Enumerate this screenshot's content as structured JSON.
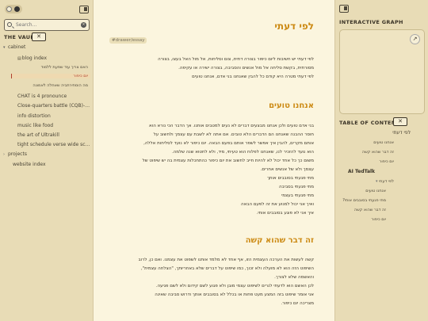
{
  "left": {
    "search": {
      "placeholder": "Search...",
      "value": ""
    },
    "vault_label": "THE VAULT",
    "collapse_glyph": "✕",
    "tree": [
      {
        "label": "cabinet",
        "kind": "folder",
        "expanded": true
      },
      {
        "label": "blog index",
        "kind": "file"
      },
      {
        "label": "האם צריך עוד שפעת ללמוד",
        "kind": "sub"
      },
      {
        "label": "יום כיפור",
        "kind": "sub",
        "active": true
      },
      {
        "label": "מה הוסתירתביה שאחלה לאמונה",
        "kind": "sub"
      },
      {
        "label": "CHAT is 4 pronounce",
        "kind": "file"
      },
      {
        "label": "Close-quarters battle (CQB)-t...",
        "kind": "file"
      },
      {
        "label": "info distortion",
        "kind": "file"
      },
      {
        "label": "music like food",
        "kind": "file"
      },
      {
        "label": "the art of Ultrakill",
        "kind": "file"
      },
      {
        "label": "tight schedule verse wide sch...",
        "kind": "file"
      },
      {
        "label": "projects",
        "kind": "folder",
        "expanded": false
      },
      {
        "label": "website index",
        "kind": "file"
      }
    ]
  },
  "main": {
    "title": "לפי דעתי",
    "tag": "#drawer/essay",
    "intro": [
      "לפי דעתי יש חשיבות ליום כיפור בצורה דתית, צום וסליחות, אל מול האל בעצו, בצורה",
      "מסורתית, בקשת סליחה אל מול אנשים והסביבה, בצורה ישירה או עקיפה.",
      "לפי דעתי מטרה היא קודם כל להבין שאנחנו בני אדם, אנחנו טועים"
    ],
    "section1": {
      "heading": "אנחנו טועים",
      "lines": [
        "בני אדם טועים ולכן אנחנו מבצעים דברים לא נעים למטבים אותנו. אך הדבר הכי נורא הוא",
        "חוסר ההבנה שאנחנו הם הדברים הלא טובים. אם אתה לא לשבת עם עצמך ולחשוב על",
        "אותם מקרים, להבין איך אפשר לשפר אותם בפעם הבאה. יום כיפור לא נועד לסליחות אללה,",
        "הוא נועד להזכיר לנו, שאנחנו לפלוח הוא טעיתי, מיד, ולא לחטוא שנה שלמה.",
        "משום כך כל אחד יכול לא להיות חייב לחשוב את יום כיפור כהתחכלות עצמית בה יש שיפוט של",
        "עצמך ולא של אנשים אחרים.",
        "מתי פגעתי בסובבים אותך",
        "מתי פגעתי בסביבה",
        "מתי פגעתי בעצמי",
        "ואיך אני יכול למנוע את זה לפעם הבאה",
        "איך אני לא פוגע בסובבים אותי."
      ]
    },
    "section2": {
      "heading": "זה דבר שהוא קשה",
      "lines": [
        "קשה לעשות את הערכה העצמית הזו, אף אחד לא מלמד אותנו לשפוט את עצמנו. ואם כן, לרוב",
        "השיפוט הזה הוא לא מועלה ולא זכוך, כמו שיפוט על דברים שלא באחריותך, \"הצלחה עצמית\",",
        "והאשמה שלא לצורך.",
        "לכן האשם הוא לדעתי לנרים לשיפוט עצמי מובן ולא פגוע לשם קידום ולא לשם פגיעה.",
        "אני אומר שיפוט בזה המצע מעט פחות או בכלל לא בסובבים אותך ודרוש סביבה שאינה",
        "מצריכה יום כיפור."
      ]
    }
  },
  "right": {
    "graph_label": "INTERACTIVE GRAPH",
    "expand_glyph": "↗",
    "toc_label": "TABLE OF CONTENTS",
    "toc_collapse_glyph": "✕",
    "toc": [
      {
        "label": "לפי דעתי",
        "level": 0
      },
      {
        "label": "אנחנו טועים",
        "level": 1
      },
      {
        "label": "זה דבר שהוא קשה",
        "level": 1
      },
      {
        "label": "יום כיפור",
        "level": 1
      },
      {
        "label": "AI TedTalk",
        "level": 0,
        "bold": true
      },
      {
        "label": "לפי דעתי",
        "level": 1,
        "chevron": true
      },
      {
        "label": "אנחנו טועים",
        "level": 2
      },
      {
        "label": "מתי פגעתי בסובבים אותי?",
        "level": 2
      },
      {
        "label": "זה דבר שהוא קשה",
        "level": 2
      },
      {
        "label": "יום כיפור",
        "level": 2
      }
    ]
  }
}
